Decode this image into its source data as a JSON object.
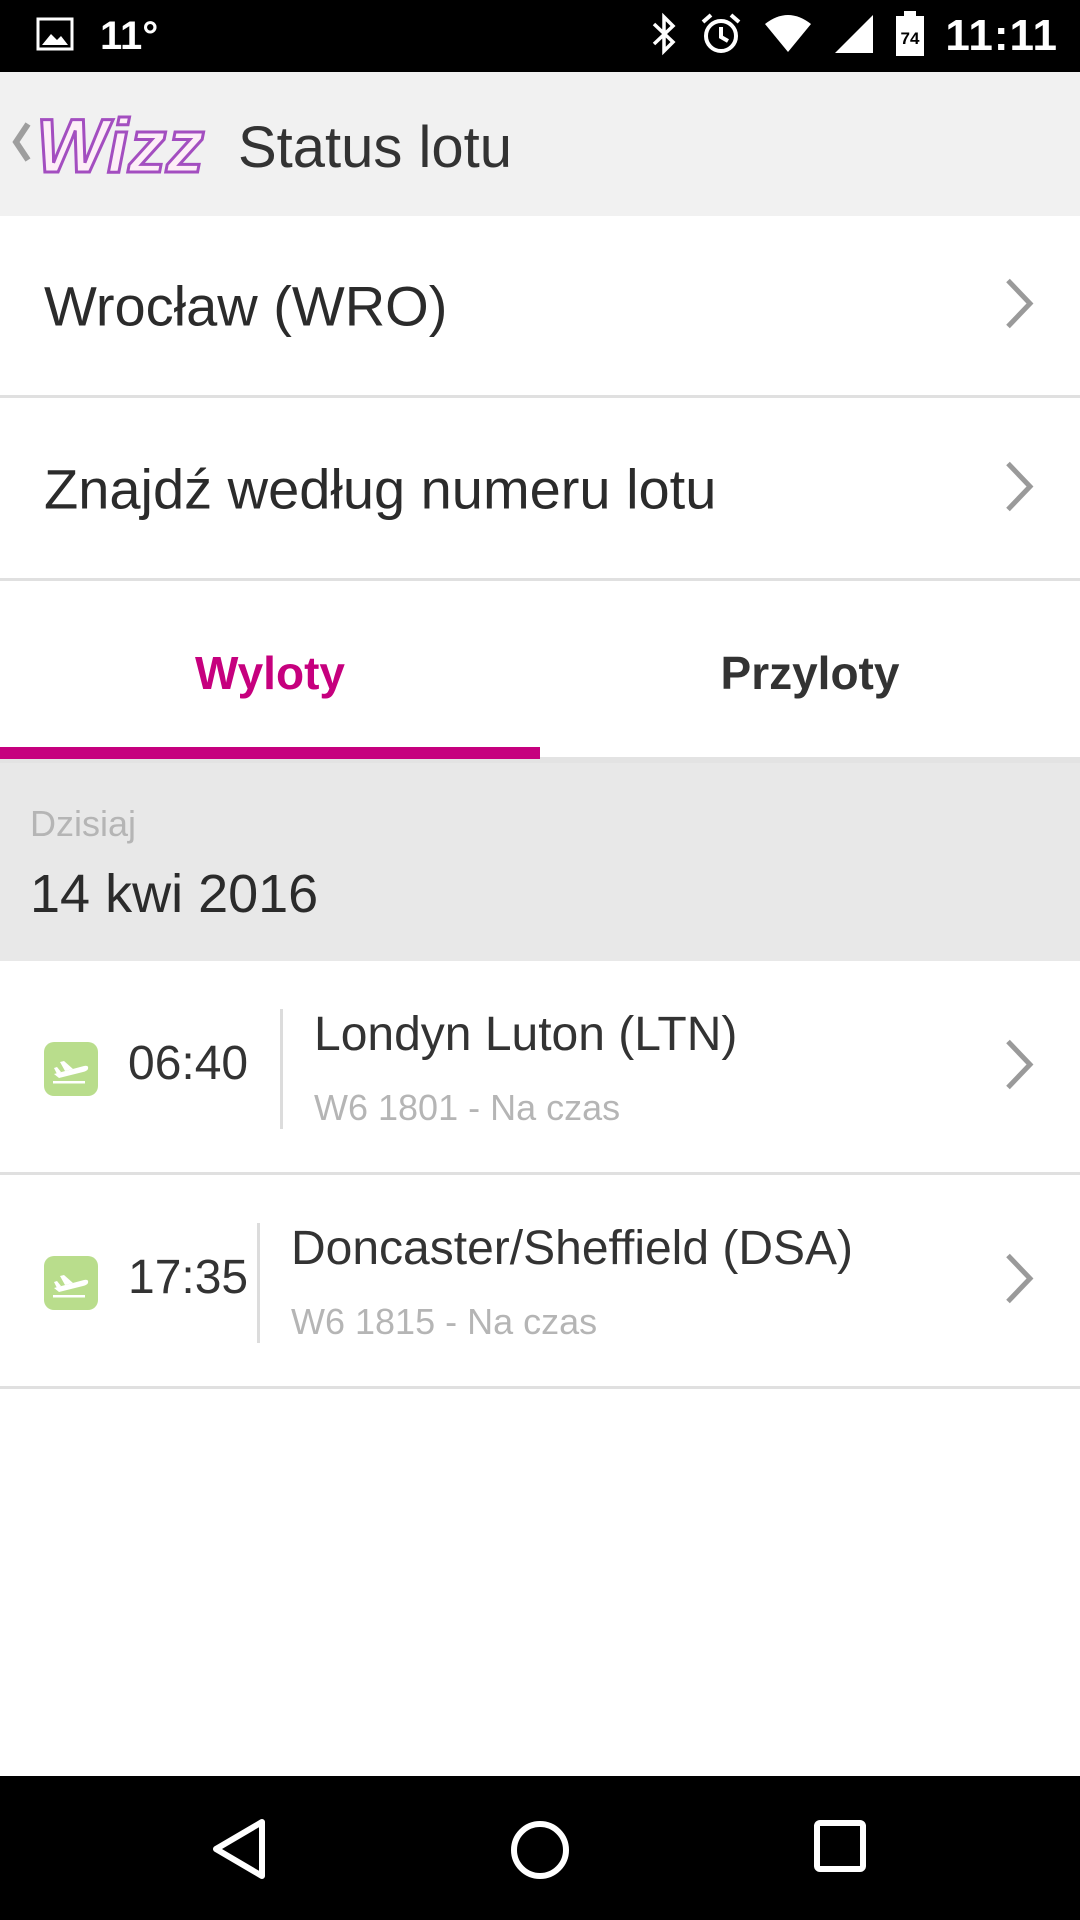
{
  "status_bar": {
    "temperature": "11°",
    "time": "11:11",
    "battery_level": "74",
    "icons": [
      "image-icon",
      "bluetooth-icon",
      "alarm-icon",
      "wifi-icon",
      "signal-icon",
      "battery-icon"
    ]
  },
  "app_bar": {
    "logo_text": "Wizz",
    "title": "Status lotu"
  },
  "airport_row": {
    "label": "Wrocław (WRO)"
  },
  "search_row": {
    "label": "Znajdź według numeru lotu"
  },
  "tabs": [
    {
      "label": "Wyloty",
      "active": true
    },
    {
      "label": "Przyloty",
      "active": false
    }
  ],
  "date_section": {
    "day_label": "Dzisiaj",
    "date": "14 kwi 2016"
  },
  "flights": [
    {
      "time": "06:40",
      "destination": "Londyn Luton (LTN)",
      "details": "W6 1801 - Na czas"
    },
    {
      "time": "17:35",
      "destination": "Doncaster/Sheffield (DSA)",
      "details": "W6 1815 - Na czas"
    }
  ],
  "colors": {
    "accent": "#c6007e",
    "status_ok": "#b9dd8c",
    "logo_purple": "#7b4fc7",
    "logo_pink": "#e2359f"
  },
  "bottom_nav": [
    "back-icon",
    "home-icon",
    "recents-icon"
  ]
}
